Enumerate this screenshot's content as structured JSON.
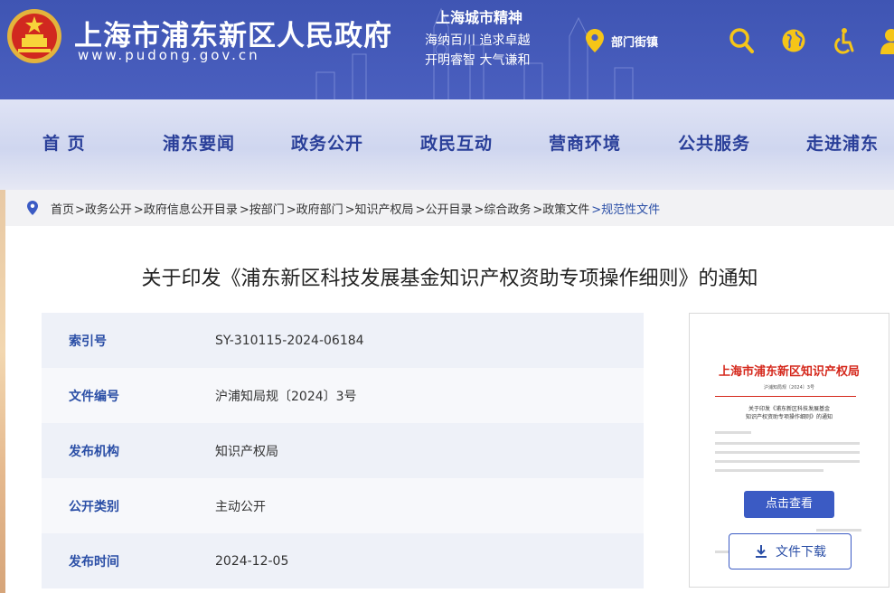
{
  "header": {
    "site_title": "上海市浦东新区人民政府",
    "site_url": "www.pudong.gov.cn",
    "spirit": {
      "title": "上海城市精神",
      "line1": "海纳百川  追求卓越",
      "line2": "开明睿智  大气谦和"
    },
    "dept_label": "部门街镇",
    "icons": [
      "search-icon",
      "globe-icon",
      "accessibility-icon",
      "user-icon"
    ]
  },
  "nav": {
    "items": [
      {
        "label": "首  页"
      },
      {
        "label": "浦东要闻"
      },
      {
        "label": "政务公开"
      },
      {
        "label": "政民互动"
      },
      {
        "label": "营商环境"
      },
      {
        "label": "公共服务"
      },
      {
        "label": "走进浦东"
      }
    ]
  },
  "breadcrumb": [
    "首页",
    ">政务公开",
    ">政府信息公开目录",
    ">按部门",
    ">政府部门",
    ">知识产权局",
    ">公开目录",
    ">综合政务",
    ">政策文件",
    ">规范性文件"
  ],
  "document": {
    "title": "关于印发《浦东新区科技发展基金知识产权资助专项操作细则》的通知",
    "meta": [
      {
        "label": "索引号",
        "value": "SY-310115-2024-06184"
      },
      {
        "label": "文件编号",
        "value": "沪浦知局规〔2024〕3号"
      },
      {
        "label": "发布机构",
        "value": "知识产权局"
      },
      {
        "label": "公开类别",
        "value": "主动公开"
      },
      {
        "label": "发布时间",
        "value": "2024-12-05"
      }
    ]
  },
  "preview": {
    "header": "上海市浦东新区知识产权局",
    "doc_no": "沪浦知局规〔2024〕3号",
    "subtitle1": "关于印发《浦东新区科技发展基金",
    "subtitle2": "知识产权资助专项操作细则》的通知",
    "view_label": "点击查看",
    "download_label": "文件下载"
  },
  "colors": {
    "header_bg": "#4a5fbf",
    "nav_text": "#2a3f99",
    "accent": "#2a4ea6",
    "icon_yellow": "#f5c518",
    "preview_red": "#d5281c"
  }
}
